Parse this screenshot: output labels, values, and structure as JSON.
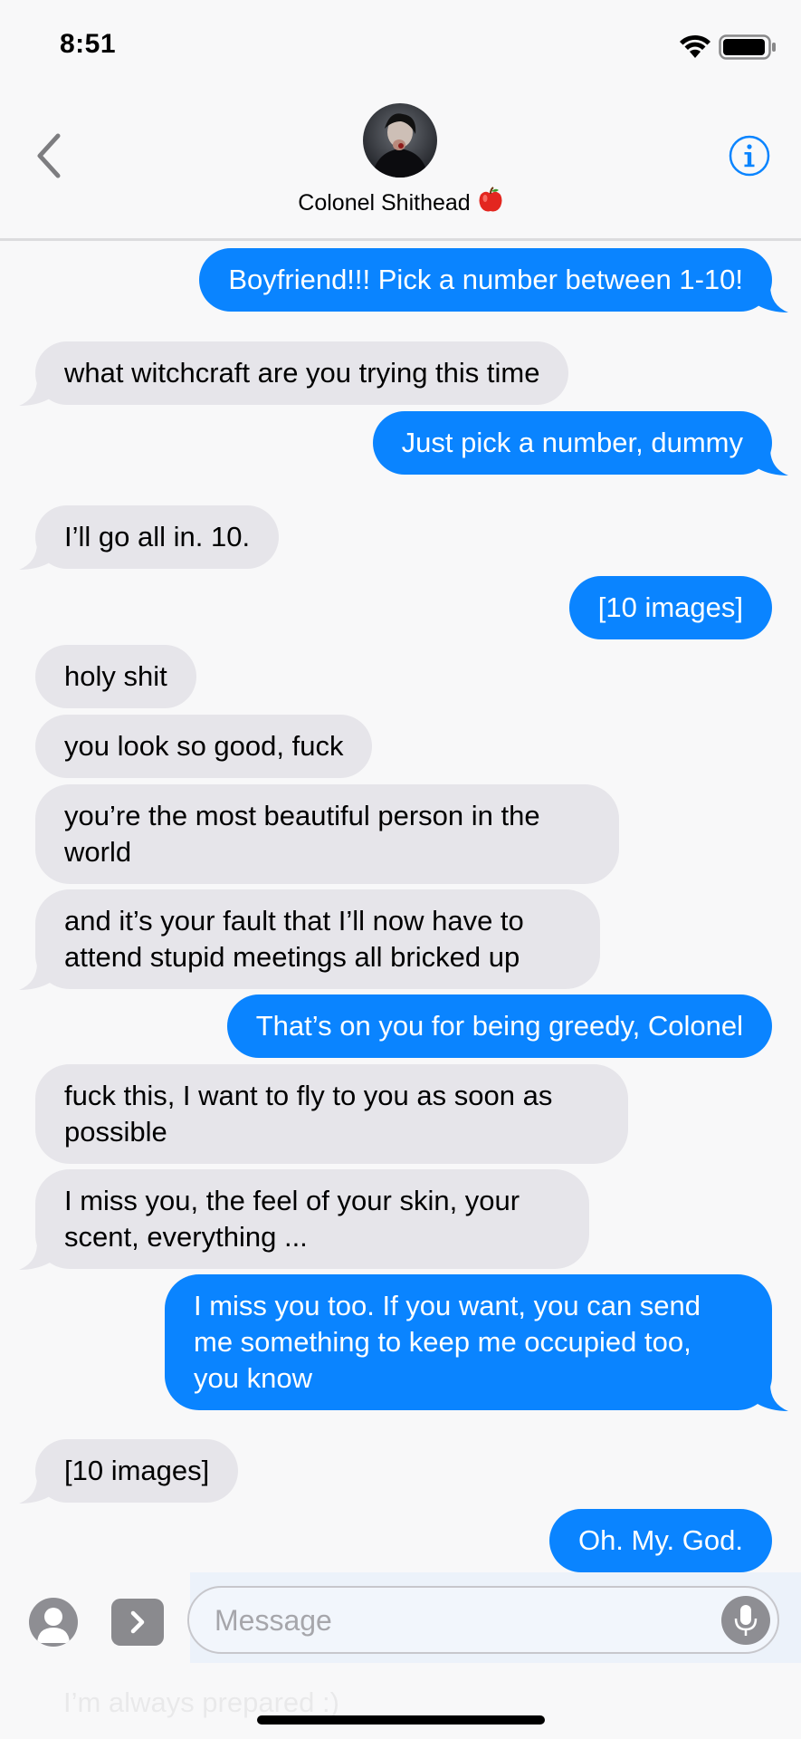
{
  "status_bar": {
    "time": "8:51"
  },
  "header": {
    "contact_name": "Colonel Shithead",
    "emoji": "🍎"
  },
  "messages": [
    {
      "from": "me",
      "text": "Boyfriend!!! Pick a number between 1-10!"
    },
    {
      "from": "them",
      "text": "what witchcraft are you trying this time"
    },
    {
      "from": "me",
      "text": "Just pick a number, dummy"
    },
    {
      "from": "them",
      "text": "I’ll go all in. 10."
    },
    {
      "from": "me",
      "text": "[10 images]"
    },
    {
      "from": "them",
      "text": "holy shit"
    },
    {
      "from": "them",
      "text": "you look so good, fuck"
    },
    {
      "from": "them",
      "text": "you’re the most beautiful person in the world"
    },
    {
      "from": "them",
      "text": "and it’s your fault that I’ll now have to attend stupid meetings all bricked up"
    },
    {
      "from": "me",
      "text": "That’s on you for being greedy, Colonel"
    },
    {
      "from": "them",
      "text": "fuck this, I want to fly to you as soon as possible"
    },
    {
      "from": "them",
      "text": "I miss you, the feel of your skin, your scent, everything ..."
    },
    {
      "from": "me",
      "text": "I miss you too. If you want, you can send me something to keep me occupied too, you know"
    },
    {
      "from": "them",
      "text": "[10 images]"
    },
    {
      "from": "me",
      "text": "Oh. My. God."
    }
  ],
  "input_bar": {
    "placeholder": "Message",
    "faded_behind": "I’m always prepared :)"
  },
  "colors": {
    "sent": "#0a84ff",
    "received": "#e6e5ea",
    "accent": "#0a84ff"
  },
  "icons": [
    "back-chevron-icon",
    "info-icon",
    "wifi-icon",
    "battery-icon",
    "camera-icon",
    "app-store-icon",
    "microphone-icon"
  ]
}
